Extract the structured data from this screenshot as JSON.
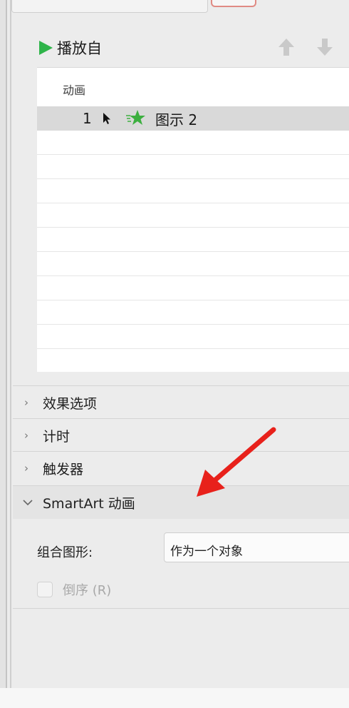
{
  "header": {
    "play_from_label": "播放自"
  },
  "animation_list": {
    "header": "动画",
    "items": [
      {
        "number": "1",
        "label": "图示 2"
      }
    ]
  },
  "sections": {
    "effect_options": "效果选项",
    "timing": "计时",
    "triggers": "触发器",
    "smartart_animation": "SmartArt 动画"
  },
  "smartart": {
    "group_graphic_label": "组合图形:",
    "group_graphic_value": "作为一个对象",
    "reverse_order_label": "倒序 (R)"
  },
  "colors": {
    "play_green": "#2fb44a",
    "star_green": "#3caf3f",
    "annotation_red": "#e8211b"
  }
}
